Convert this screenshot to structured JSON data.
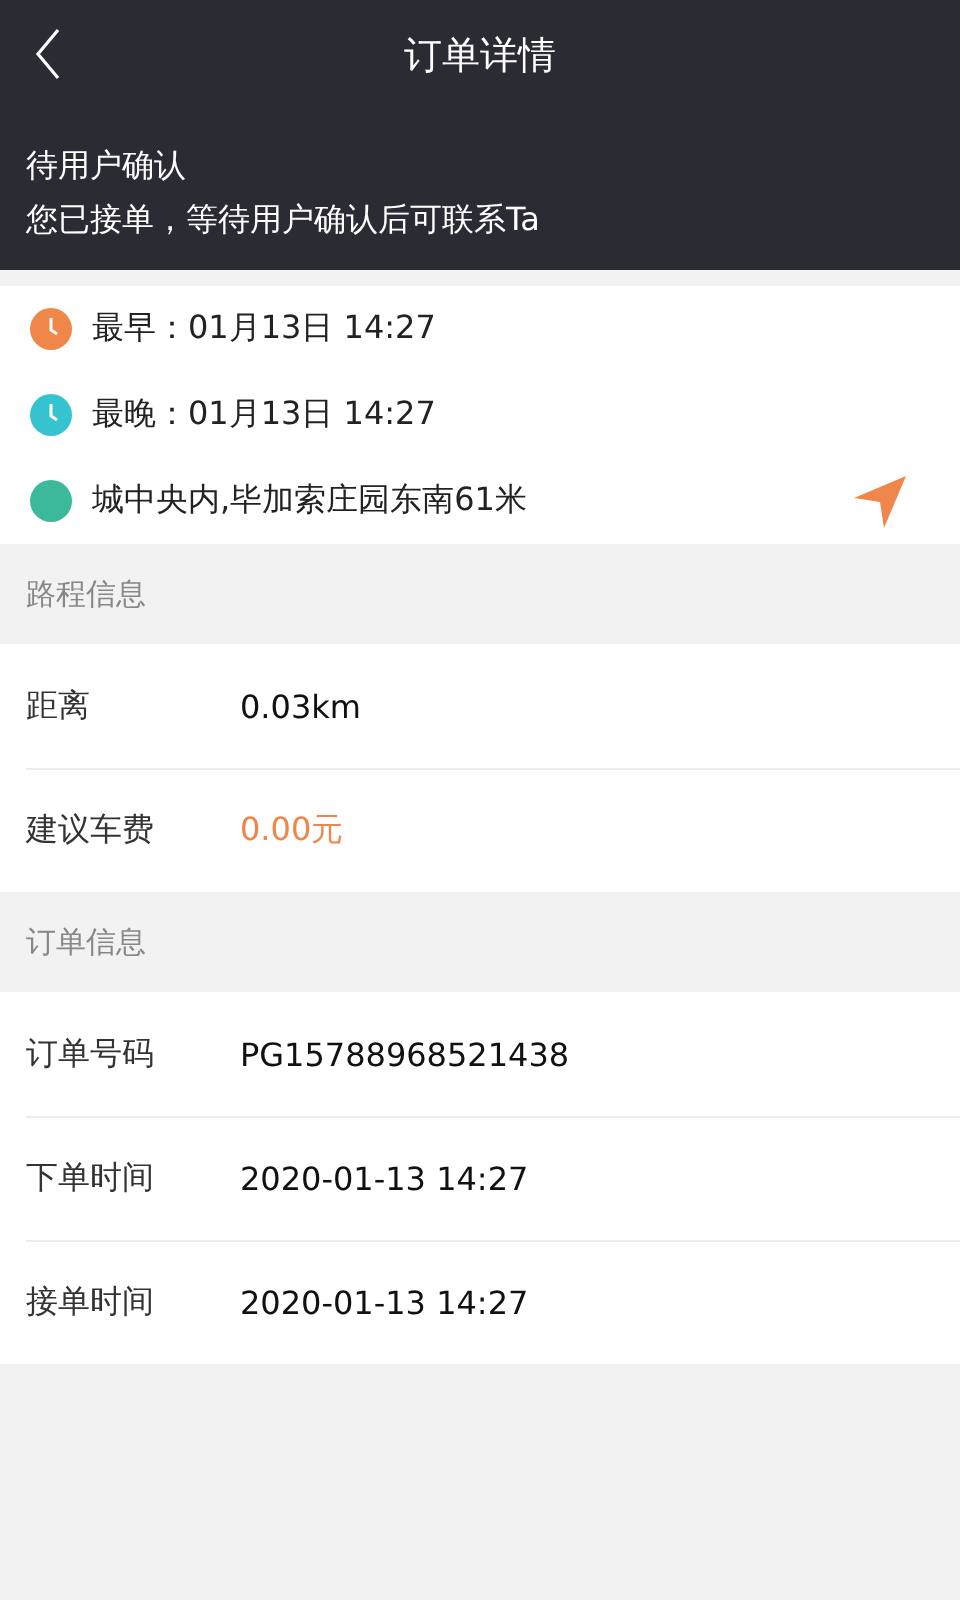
{
  "header": {
    "title": "订单详情"
  },
  "status": {
    "title": "待用户确认",
    "message": "您已接单，等待用户确认后可联系Ta"
  },
  "times": [
    {
      "kind": "clock",
      "color": "#f0874a",
      "text": "最早：01月13日 14:27"
    },
    {
      "kind": "clock",
      "color": "#35c4cf",
      "text": "最晚：01月13日 14:27"
    },
    {
      "kind": "place",
      "color": "#3cb89a",
      "text": "城中央内,毕加索庄园东南61米"
    }
  ],
  "sections": [
    {
      "title": "路程信息",
      "rows": [
        {
          "label": "距离",
          "value": "0.03km",
          "kind": "plain"
        },
        {
          "label": "建议车费",
          "value": "0.00元",
          "kind": "price"
        }
      ]
    },
    {
      "title": "订单信息",
      "rows": [
        {
          "label": "订单号码",
          "value": "PG15788968521438",
          "kind": "plain"
        },
        {
          "label": "下单时间",
          "value": "2020-01-13 14:27",
          "kind": "plain"
        },
        {
          "label": "接单时间",
          "value": "2020-01-13 14:27",
          "kind": "plain"
        }
      ]
    }
  ]
}
